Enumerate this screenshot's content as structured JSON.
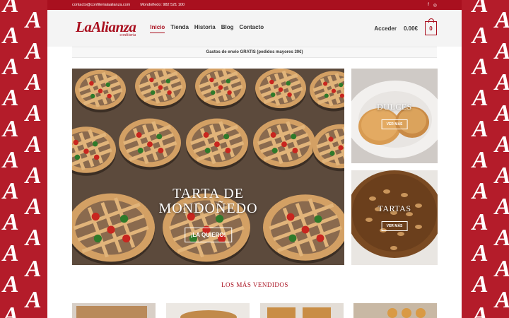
{
  "topbar": {
    "email": "contacto@confiterialaalianza.com",
    "phone": "Mondoñedo: 982 521 100",
    "social": [
      {
        "name": "facebook-icon",
        "glyph": "f"
      },
      {
        "name": "instagram-icon",
        "glyph": "◎"
      }
    ]
  },
  "logo": {
    "main": "LaAlianza",
    "sub": "confitería"
  },
  "nav": [
    {
      "label": "Inicio",
      "active": true
    },
    {
      "label": "Tienda",
      "active": false
    },
    {
      "label": "Historia",
      "active": false
    },
    {
      "label": "Blog",
      "active": false
    },
    {
      "label": "Contacto",
      "active": false
    }
  ],
  "header": {
    "login_label": "Acceder",
    "cart_total": "0.00€",
    "cart_count": "0"
  },
  "shipping_notice": "Gastos de envío GRATIS (pedidos mayores 30€)",
  "hero": {
    "title_line1": "TARTA DE",
    "title_line2": "MONDOÑEDO",
    "cta": "¡LA QUIERO!"
  },
  "side_cards": [
    {
      "title": "DULCES",
      "cta": "VER MÁS"
    },
    {
      "title": "TARTAS",
      "cta": "VER MÁS"
    }
  ],
  "bestsellers": {
    "title": "LOS MÁS VENDIDOS"
  },
  "colors": {
    "brand": "#a9101f",
    "background": "#b41c2a"
  }
}
